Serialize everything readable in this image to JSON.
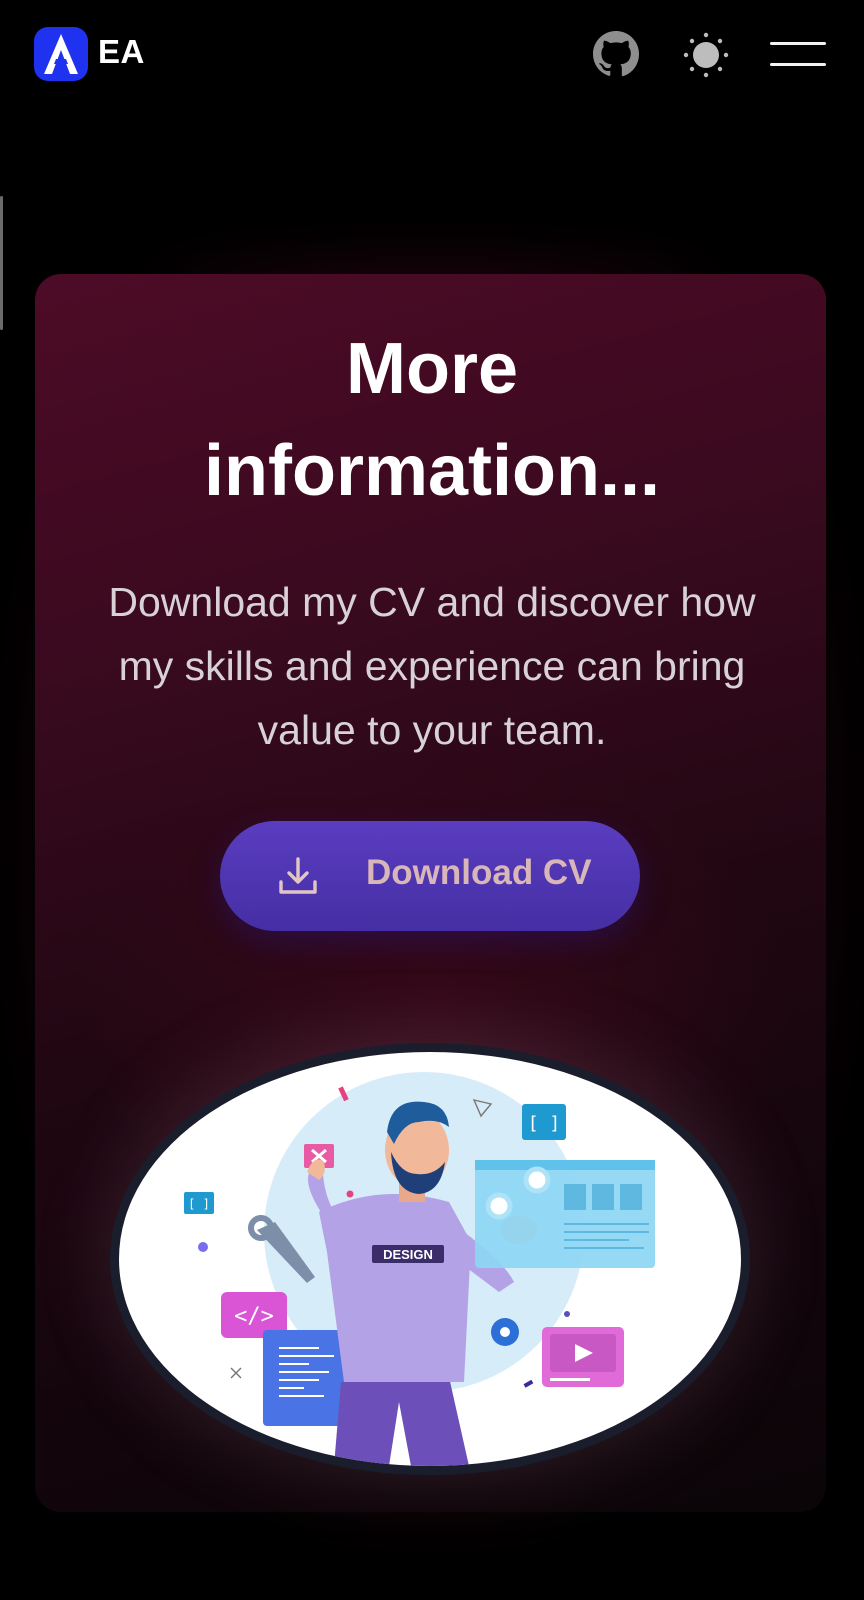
{
  "header": {
    "brand": "EA",
    "logo_letter": "A",
    "icons": [
      "github-icon",
      "sun-icon",
      "hamburger-menu-icon"
    ]
  },
  "card": {
    "title_line1": "More",
    "title_line2": "information...",
    "description_line1": "Download my CV and discover how",
    "description_line2": "my skills and experience can bring",
    "description_line3": "value to your team.",
    "button_label": "Download CV",
    "button_icon": "download-icon"
  },
  "illustration": {
    "shirt_text": "DESIGN"
  },
  "colors": {
    "background": "#000000",
    "card_top": "#4d0b26",
    "button": "#4d35b2",
    "button_text": "#d9b7b8",
    "logo": "#1f32f0"
  }
}
